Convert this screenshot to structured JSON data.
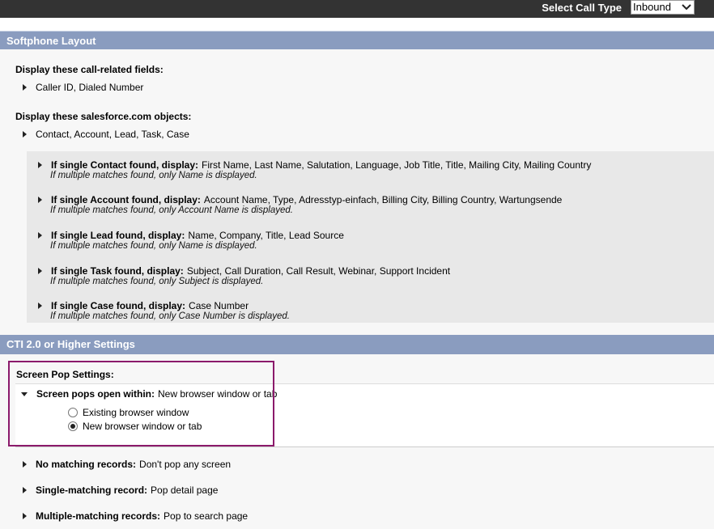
{
  "topbar": {
    "call_type_label": "Select Call Type",
    "call_type_value": "Inbound"
  },
  "softphone": {
    "header": "Softphone Layout",
    "fields_label": "Display these call-related fields:",
    "fields_value": "Caller ID, Dialed Number",
    "objects_label": "Display these salesforce.com objects:",
    "objects_value": "Contact, Account, Lead, Task, Case",
    "objects": [
      {
        "title": "If single Contact found, display:",
        "fields": "First Name, Last Name, Salutation, Language, Job Title, Title, Mailing City, Mailing Country",
        "note": "If multiple matches found, only Name is displayed."
      },
      {
        "title": "If single Account found, display:",
        "fields": "Account Name, Type, Adresstyp-einfach, Billing City, Billing Country, Wartungsende",
        "note": "If multiple matches found, only Account Name is displayed."
      },
      {
        "title": "If single Lead found, display:",
        "fields": "Name, Company, Title, Lead Source",
        "note": "If multiple matches found, only Name is displayed."
      },
      {
        "title": "If single Task found, display:",
        "fields": "Subject, Call Duration, Call Result, Webinar, Support Incident",
        "note": "If multiple matches found, only Subject is displayed."
      },
      {
        "title": "If single Case found, display:",
        "fields": "Case Number",
        "note": "If multiple matches found, only Case Number is displayed."
      }
    ]
  },
  "cti": {
    "header": "CTI 2.0 or Higher Settings",
    "screen_pop_label": "Screen Pop Settings:",
    "opens_within_label": "Screen pops open within:",
    "opens_within_value": "New browser window or tab",
    "options": [
      {
        "label": "Existing browser window",
        "selected": false
      },
      {
        "label": "New browser window or tab",
        "selected": true
      }
    ],
    "rules": [
      {
        "label": "No matching records:",
        "value": "Don't pop any screen"
      },
      {
        "label": "Single-matching record:",
        "value": "Pop detail page"
      },
      {
        "label": "Multiple-matching records:",
        "value": "Pop to search page"
      }
    ]
  }
}
